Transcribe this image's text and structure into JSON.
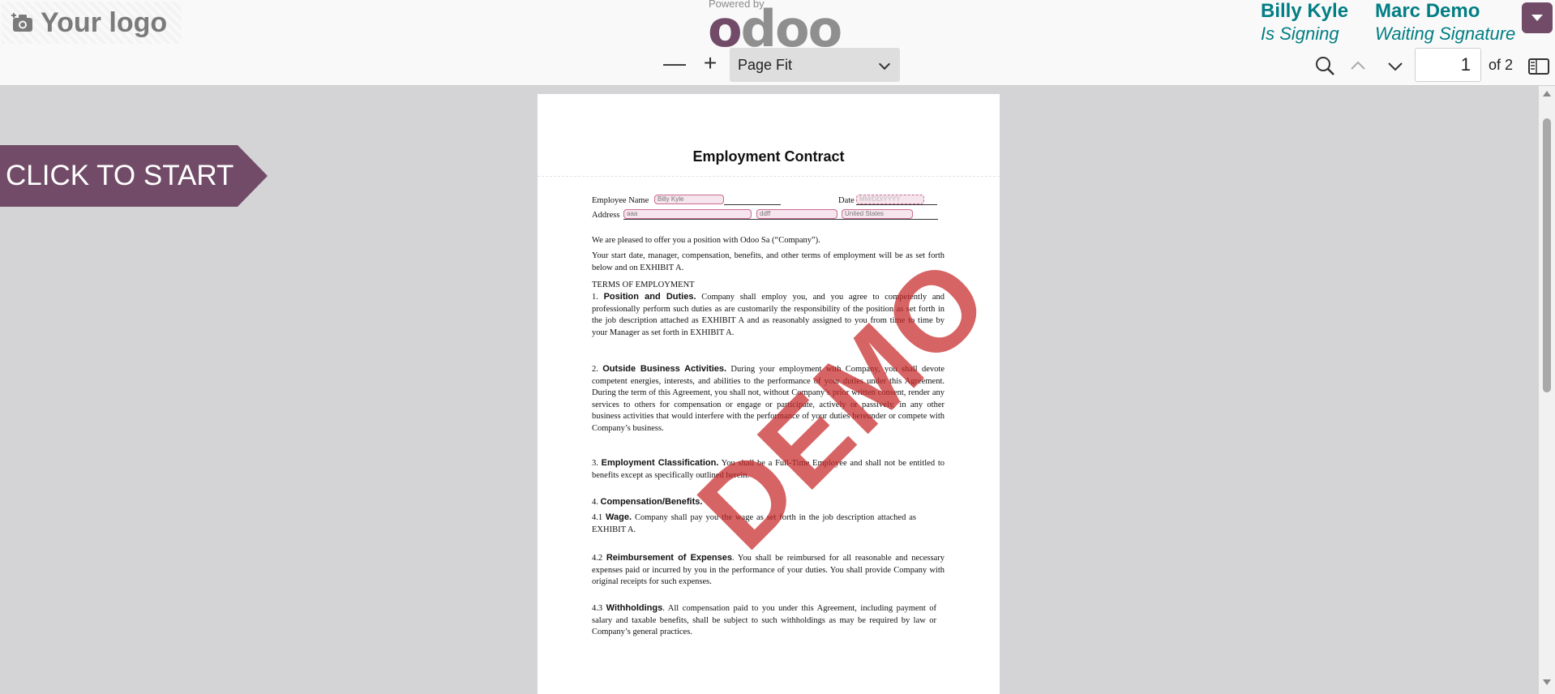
{
  "header": {
    "logo_text": "Your logo",
    "powered_by": "Powered by",
    "brand": "odoo",
    "signers": [
      {
        "name": "Billy Kyle",
        "status": "Is Signing"
      },
      {
        "name": "Marc Demo",
        "status": "Waiting Signature"
      }
    ],
    "brand_color": "#714b67",
    "accent_color": "#017e84"
  },
  "toolbar": {
    "zoom_out": "—",
    "zoom_in": "+",
    "zoom_value": "Page Fit",
    "page_number": "1",
    "page_count": "of 2",
    "icons": [
      "search-icon",
      "chevron-up-icon",
      "chevron-down-icon",
      "sidebar-toggle-icon"
    ]
  },
  "start_button": "CLICK TO START",
  "document": {
    "title": "Employment Contract",
    "watermark": "DEMO",
    "employee_name_label": "Employee Name",
    "employee_name_value": "Billy Kyle",
    "date_label": "Date",
    "date_placeholder": "MM/DD/YYYY",
    "address_label": "Address",
    "address_value_1": "aaa",
    "address_value_2": "ddff",
    "address_value_3": "United States",
    "intro_1": "We are pleased to offer you a position with Odoo Sa (“Company”).",
    "intro_2": "Your start date, manager, compensation, benefits, and other terms of employment will be as set forth below and on EXHIBIT A.",
    "terms_heading": "TERMS OF EMPLOYMENT",
    "s1_num": "1.",
    "s1_title": "Position and Duties.",
    "s1_text": " Company shall employ you, and you agree to competently and professionally perform such duties as are customarily the responsibility of the position as set forth in the job description attached as EXHIBIT A and as reasonably assigned to you from time to time by your Manager as set forth in EXHIBIT A.",
    "s2_num": "2.",
    "s2_title": "Outside Business Activities.",
    "s2_text": " During your employment with Company, you shall devote competent energies, interests, and abilities to the performance of your duties under this Agreement. During the term of this Agreement, you shall not, without Company’s prior written consent, render any services to others for compensation or engage or participate, actively or passively, in any other business activities that would interfere with the performance of your duties hereunder or compete with Company’s business.",
    "s3_num": "3.",
    "s3_title": "Employment Classification.",
    "s3_text": " You shall be a Full-Time Employee and shall not be entitled to benefits except as specifically outlined herein.",
    "s4_num": "4.",
    "s4_title": "Compensation/Benefits.",
    "s41_num": "4.1",
    "s41_title": "Wage.",
    "s41_text": " Company shall pay you the wage as set forth in the job description attached as EXHIBIT A.",
    "s42_num": "4.2",
    "s42_title": "Reimbursement of Expenses",
    "s42_text": ". You shall be reimbursed for all reasonable and necessary expenses paid or incurred by you in the performance of your duties. You shall provide Company with original receipts for such expenses.",
    "s43_num": "4.3",
    "s43_title": "Withholdings",
    "s43_text": ". All compensation paid to you under this Agreement, including payment of salary and taxable benefits, shall be subject to such withholdings as may be required by law or Company’s general practices."
  }
}
